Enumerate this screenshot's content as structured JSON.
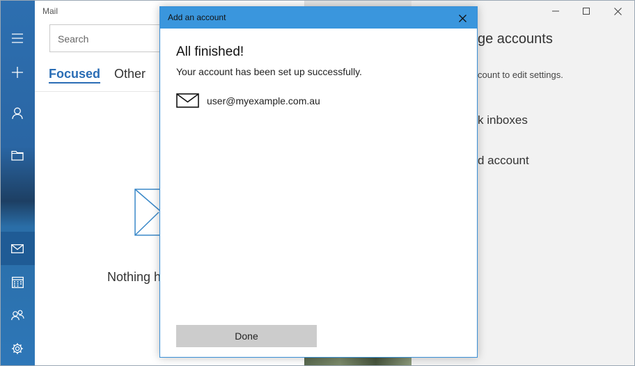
{
  "mail": {
    "app_title": "Mail",
    "search_placeholder": "Search",
    "tabs": [
      {
        "label": "Focused"
      },
      {
        "label": "Other"
      }
    ],
    "empty_text": "Nothing h"
  },
  "rail": {
    "items": [
      {
        "icon": "hamburger-icon"
      },
      {
        "icon": "compose-plus-icon"
      },
      {
        "icon": "person-icon"
      },
      {
        "icon": "folder-icon"
      },
      {
        "icon": "mail-icon"
      },
      {
        "icon": "calendar-icon"
      },
      {
        "icon": "people-icon"
      },
      {
        "icon": "gear-icon"
      }
    ]
  },
  "settings": {
    "title": "ge accounts",
    "description": "count to edit settings.",
    "links": [
      "k inboxes",
      "d account"
    ]
  },
  "dialog": {
    "title": "Add an account",
    "heading": "All finished!",
    "subtitle": "Your account has been set up successfully.",
    "account_email": "user@myexample.com.au",
    "done_label": "Done"
  },
  "colors": {
    "accent": "#3a96dd",
    "focused_tab": "#2a6db5",
    "done_button_bg": "#cccccc"
  }
}
